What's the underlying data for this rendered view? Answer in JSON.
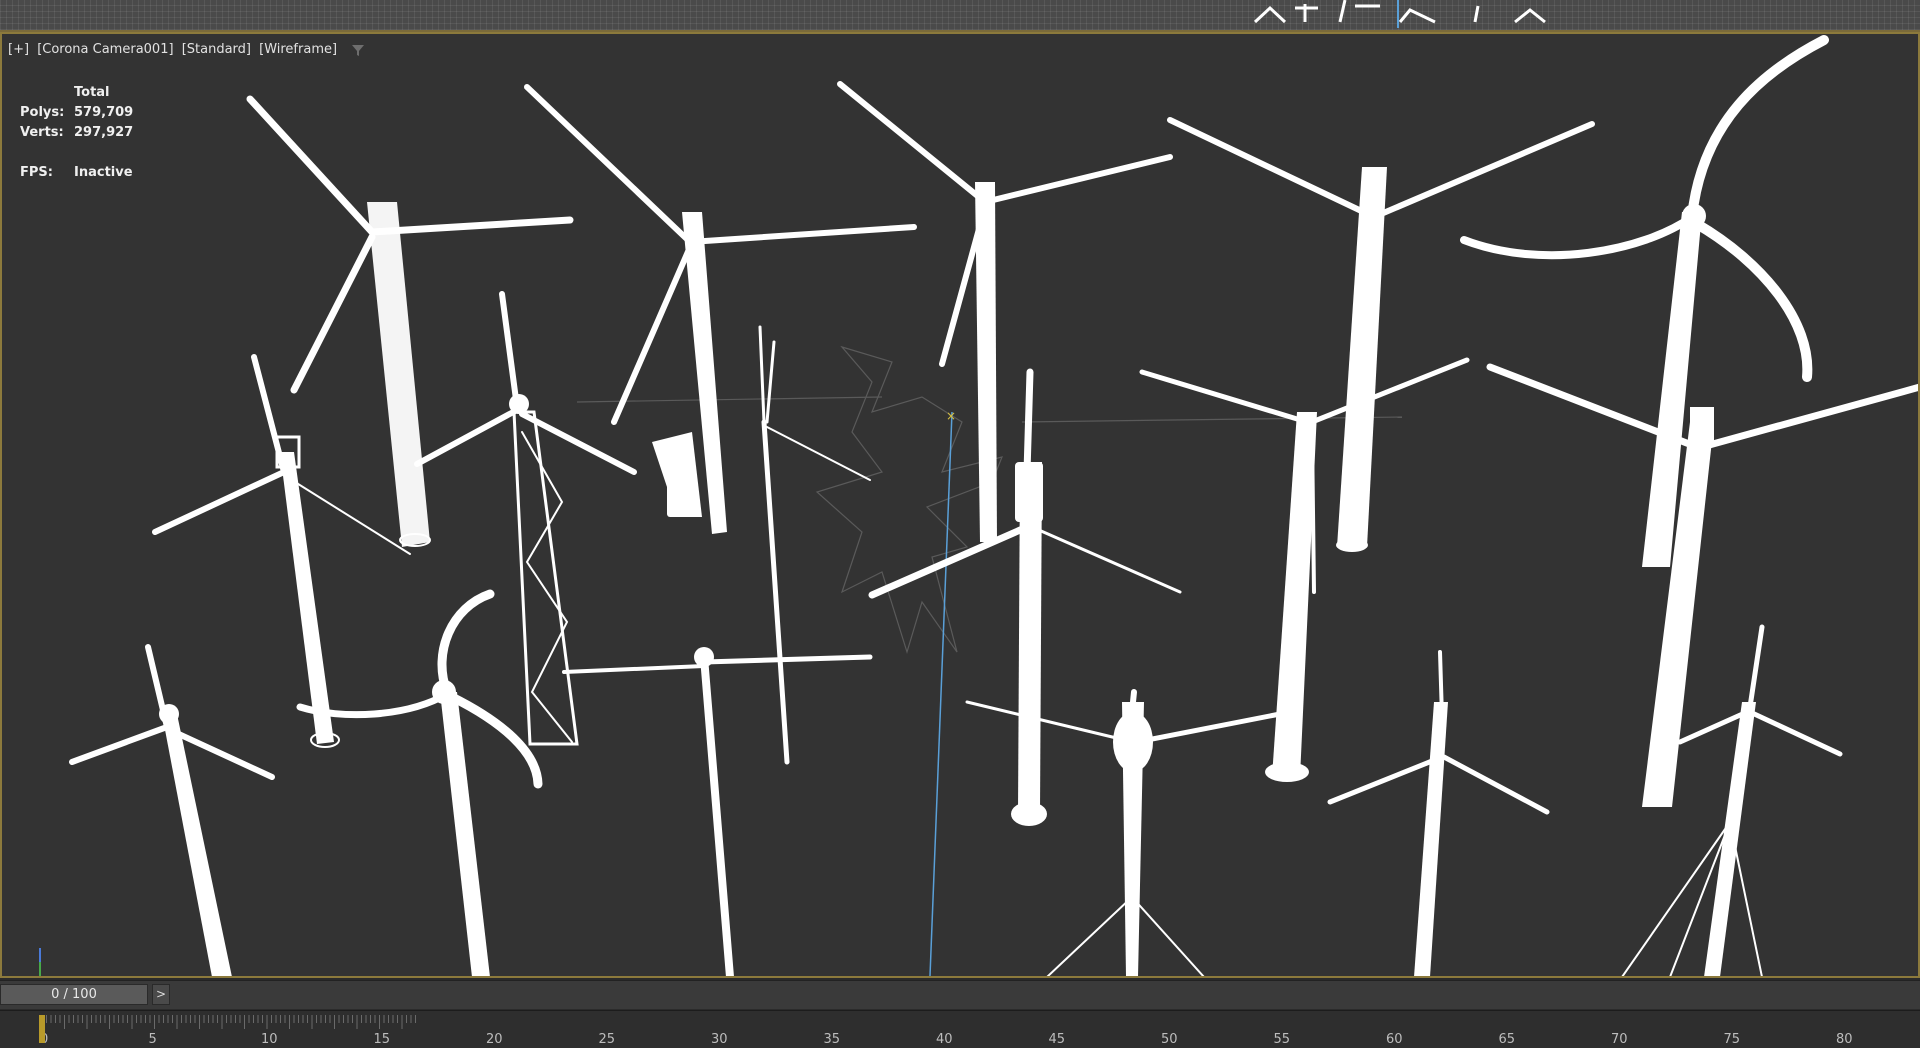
{
  "viewport": {
    "label_items": [
      "[+]",
      "[Corona Camera001]",
      "[Standard]",
      "[Wireframe]"
    ],
    "filter_icon": "filter-icon"
  },
  "stats": {
    "header": "Total",
    "polys_label": "Polys:",
    "polys_value": "579,709",
    "verts_label": "Verts:",
    "verts_value": "297,927",
    "fps_label": "FPS:",
    "fps_value": "Inactive"
  },
  "timeline": {
    "frame_display": "0 / 100",
    "next_label": ">",
    "current_frame": 0,
    "total_frames": 100,
    "tick_labels": [
      "0",
      "5",
      "10",
      "15",
      "20",
      "25",
      "30",
      "35",
      "40",
      "45",
      "50",
      "55",
      "60",
      "65",
      "70",
      "75",
      "80"
    ]
  },
  "colors": {
    "viewport_bg": "#333333",
    "active_border": "#8c7a3c",
    "wireframe": "#ffffff",
    "camera_target_line": "#5aa0d8"
  }
}
